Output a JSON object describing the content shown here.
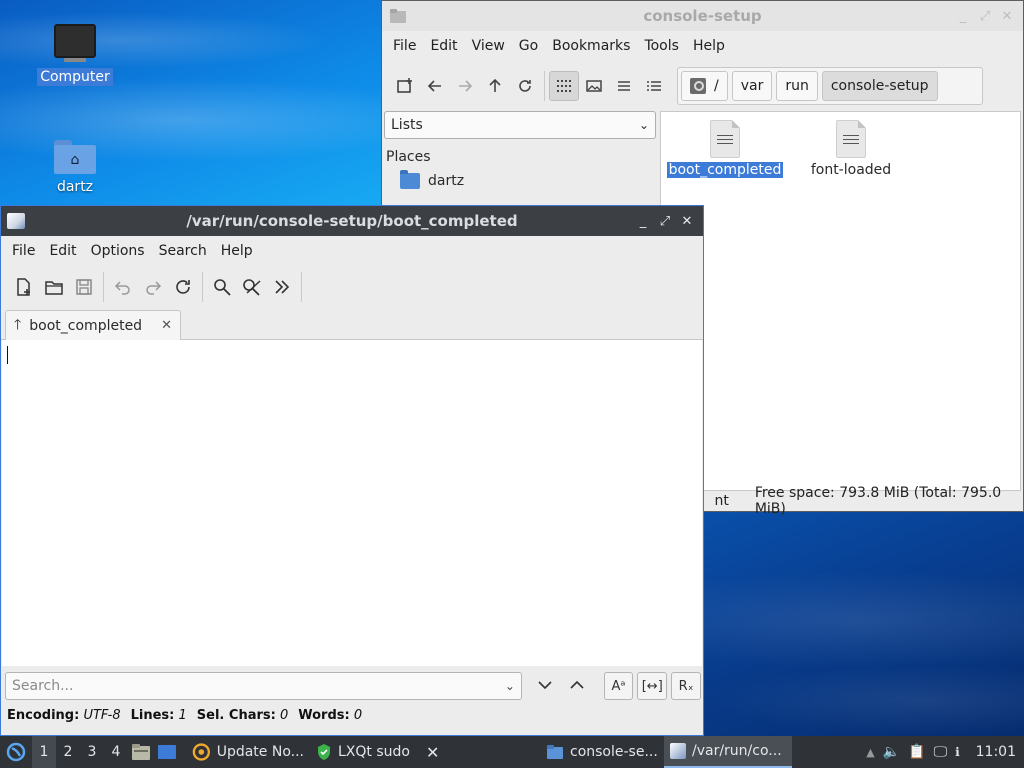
{
  "desktop": {
    "icons": [
      {
        "label": "Computer"
      },
      {
        "label": "dartz"
      }
    ]
  },
  "file_manager": {
    "title": "console-setup",
    "menu": [
      "File",
      "Edit",
      "View",
      "Go",
      "Bookmarks",
      "Tools",
      "Help"
    ],
    "path": {
      "root": "/",
      "segments": [
        "var",
        "run",
        "console-setup"
      ]
    },
    "side_select": "Lists",
    "places_title": "Places",
    "places": [
      {
        "label": "dartz"
      }
    ],
    "files": [
      {
        "name": "boot_completed",
        "selected": true
      },
      {
        "name": "font-loaded",
        "selected": false
      }
    ],
    "status_left": "nt",
    "status_right": "Free space: 793.8 MiB (Total: 795.0 MiB)"
  },
  "editor": {
    "title": "/var/run/console-setup/boot_completed",
    "menu": [
      "File",
      "Edit",
      "Options",
      "Search",
      "Help"
    ],
    "tab_label": "boot_completed",
    "search_placeholder": "Search...",
    "status": {
      "encoding_label": "Encoding:",
      "encoding_value": "UTF-8",
      "lines_label": "Lines:",
      "lines_value": "1",
      "sel_label": "Sel. Chars:",
      "sel_value": "0",
      "words_label": "Words:",
      "words_value": "0"
    }
  },
  "taskbar": {
    "desktops": [
      "1",
      "2",
      "3",
      "4"
    ],
    "tasks": [
      {
        "label": "Update No..."
      },
      {
        "label": "LXQt sudo"
      },
      {
        "label": "console-se..."
      },
      {
        "label": "/var/run/co..."
      }
    ],
    "clock": "11:01"
  }
}
